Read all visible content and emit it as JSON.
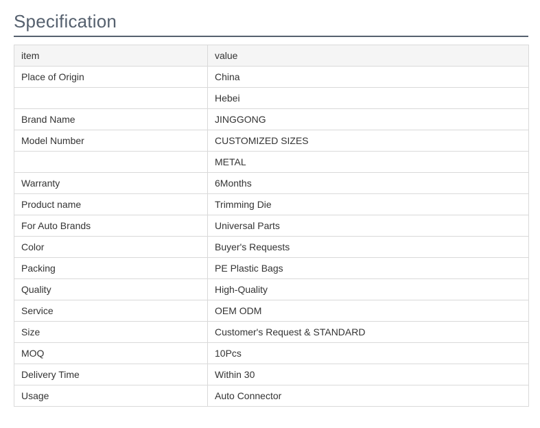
{
  "heading": "Specification",
  "table": {
    "header": {
      "item": "item",
      "value": "value"
    },
    "rows": [
      {
        "item": "Place of Origin",
        "value": "China"
      },
      {
        "item": "",
        "value": "Hebei"
      },
      {
        "item": "Brand Name",
        "value": "JINGGONG"
      },
      {
        "item": "Model Number",
        "value": "CUSTOMIZED SIZES"
      },
      {
        "item": "",
        "value": "METAL"
      },
      {
        "item": "Warranty",
        "value": "6Months"
      },
      {
        "item": "Product name",
        "value": "Trimming Die"
      },
      {
        "item": "For Auto Brands",
        "value": "Universal Parts"
      },
      {
        "item": "Color",
        "value": "Buyer's Requests"
      },
      {
        "item": "Packing",
        "value": "PE Plastic Bags"
      },
      {
        "item": "Quality",
        "value": "High-Quality"
      },
      {
        "item": "Service",
        "value": "OEM ODM"
      },
      {
        "item": "Size",
        "value": "Customer's Request & STANDARD"
      },
      {
        "item": "MOQ",
        "value": "10Pcs"
      },
      {
        "item": "Delivery Time",
        "value": "Within 30"
      },
      {
        "item": "Usage",
        "value": "Auto Connector"
      }
    ]
  }
}
